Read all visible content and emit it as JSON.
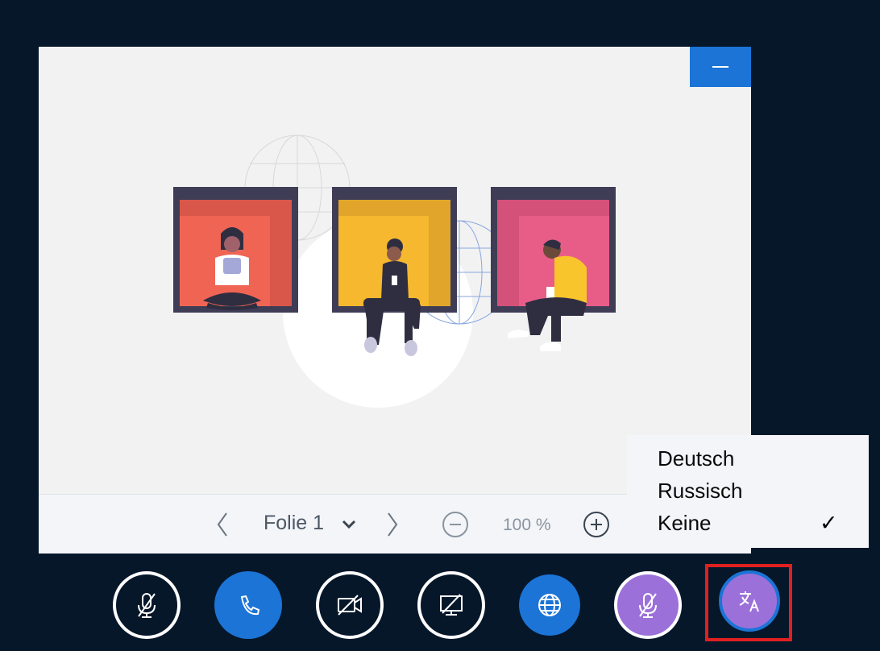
{
  "slide_controls": {
    "slide_label": "Folie 1",
    "zoom": "100 %"
  },
  "language_menu": {
    "items": [
      "Deutsch",
      "Russisch",
      "Keine"
    ],
    "selected": "Keine",
    "check_mark": "✓"
  },
  "icons": {
    "minimize": "minus-icon",
    "prev": "chevron-left-icon",
    "next": "chevron-right-icon",
    "slide_dropdown": "chevron-down-icon",
    "zoom_out": "zoom-out-icon",
    "zoom_in": "zoom-in-icon",
    "mute": "microphone-off-icon",
    "phone": "phone-icon",
    "camera": "camera-off-icon",
    "screen": "screen-share-off-icon",
    "globe": "globe-icon",
    "interpreter_mic": "microphone-off-icon",
    "translate": "translate-icon"
  },
  "colors": {
    "background": "#06172a",
    "accent_blue": "#1b74d6",
    "accent_purple": "#9b71d9",
    "highlight_red": "#e02020",
    "box_coral": "#f06454",
    "box_yellow": "#f5b82e",
    "box_pink": "#e85d88",
    "frame": "#3f3d56",
    "shirt_yellow": "#f8c52c"
  }
}
